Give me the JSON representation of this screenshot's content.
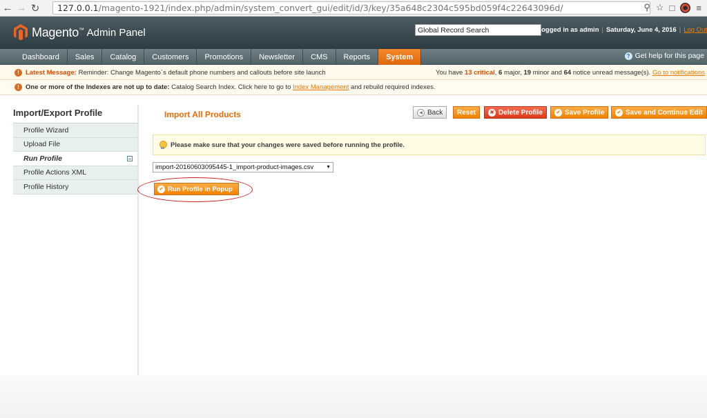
{
  "browser": {
    "url_host": "127.0.0.1",
    "url_path": "/magento-1921/index.php/admin/system_convert_gui/edit/id/3/key/35a648c2304c595bd059f4c22643096d/"
  },
  "header": {
    "logo": "Magento",
    "logo_mark": "™",
    "logo_sub": "Admin Panel",
    "search_value": "Global Record Search",
    "logged_in": "Logged in as admin",
    "date": "Saturday, June 4, 2016",
    "logout": "Log Out"
  },
  "nav": {
    "items": [
      "Dashboard",
      "Sales",
      "Catalog",
      "Customers",
      "Promotions",
      "Newsletter",
      "CMS",
      "Reports",
      "System"
    ],
    "active": "System",
    "help": "Get help for this page"
  },
  "notices": {
    "latest_label": "Latest Message:",
    "latest_text": "Reminder: Change Magento`s default phone numbers and callouts before site launch",
    "summary_pre": "You have",
    "critical": "13 critical",
    "major": "6",
    "major_label": "major,",
    "minor": "19",
    "minor_label": "minor and",
    "notice": "64",
    "notice_label": "notice unread message(s).",
    "go_to": "Go to notifications",
    "index_label": "One or more of the Indexes are not up to date:",
    "index_text": "Catalog Search Index. Click here to go to",
    "index_link": "Index Management",
    "index_tail": "and rebuild required indexes."
  },
  "sidebar": {
    "title": "Import/Export Profile",
    "items": [
      {
        "label": "Profile Wizard"
      },
      {
        "label": "Upload File"
      },
      {
        "label": "Run Profile"
      },
      {
        "label": "Profile Actions XML"
      },
      {
        "label": "Profile History"
      }
    ],
    "active_index": 2
  },
  "main": {
    "title": "Import All Products",
    "buttons": {
      "back": "Back",
      "reset": "Reset",
      "delete": "Delete Profile",
      "save": "Save Profile",
      "save_continue": "Save and Continue Edit"
    },
    "warning": "Please make sure that your changes were saved before running the profile.",
    "file_selected": "import-20160603095445-1_import-product-images.csv",
    "run_button": "Run Profile in Popup"
  },
  "colors": {
    "accent": "#f18200",
    "title_orange": "#ea6a05",
    "highlight_ellipse": "#d41b1b"
  }
}
